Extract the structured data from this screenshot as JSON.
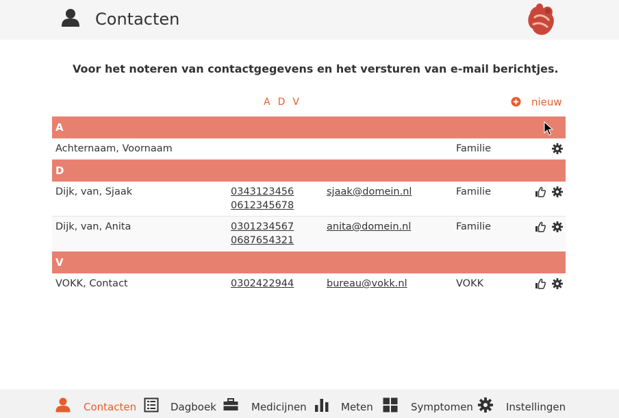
{
  "header": {
    "title": "Contacten",
    "icon": "user-icon",
    "logo": "app-logo"
  },
  "intro": "Voor het noteren van contactgegevens en het versturen van e-mail berichtjes.",
  "index_letters": [
    "A",
    "D",
    "V"
  ],
  "new_button": {
    "label": "nieuw",
    "icon": "plus-circle-icon"
  },
  "colors": {
    "accent": "#e85c2b",
    "group_header": "#e88070",
    "header_bg": "#f5f5f5",
    "footer_bg": "#f2f2f2",
    "text": "#333333"
  },
  "groups": [
    {
      "letter": "A",
      "contacts": [
        {
          "name": "Achternaam, Voornaam",
          "phones": [],
          "email": "",
          "group": "Familie",
          "has_thumb": false
        }
      ]
    },
    {
      "letter": "D",
      "contacts": [
        {
          "name": "Dijk, van, Sjaak",
          "phones": [
            "0343123456",
            "0612345678"
          ],
          "email": "sjaak@domein.nl",
          "group": "Familie",
          "has_thumb": true
        },
        {
          "name": "Dijk, van, Anita",
          "phones": [
            "0301234567",
            "0687654321"
          ],
          "email": "anita@domein.nl",
          "group": "Familie",
          "has_thumb": true
        }
      ]
    },
    {
      "letter": "V",
      "contacts": [
        {
          "name": "VOKK, Contact",
          "phones": [
            "0302422944"
          ],
          "email": "bureau@vokk.nl",
          "group": "VOKK",
          "has_thumb": true
        }
      ]
    }
  ],
  "nav": [
    {
      "label": "Contacten",
      "icon": "user-icon",
      "active": true
    },
    {
      "label": "Dagboek",
      "icon": "list-icon",
      "active": false
    },
    {
      "label": "Medicijnen",
      "icon": "briefcase-icon",
      "active": false
    },
    {
      "label": "Meten",
      "icon": "bar-chart-icon",
      "active": false
    },
    {
      "label": "Symptomen",
      "icon": "grid-icon",
      "active": false
    },
    {
      "label": "Instellingen",
      "icon": "gear-icon",
      "active": false
    }
  ]
}
